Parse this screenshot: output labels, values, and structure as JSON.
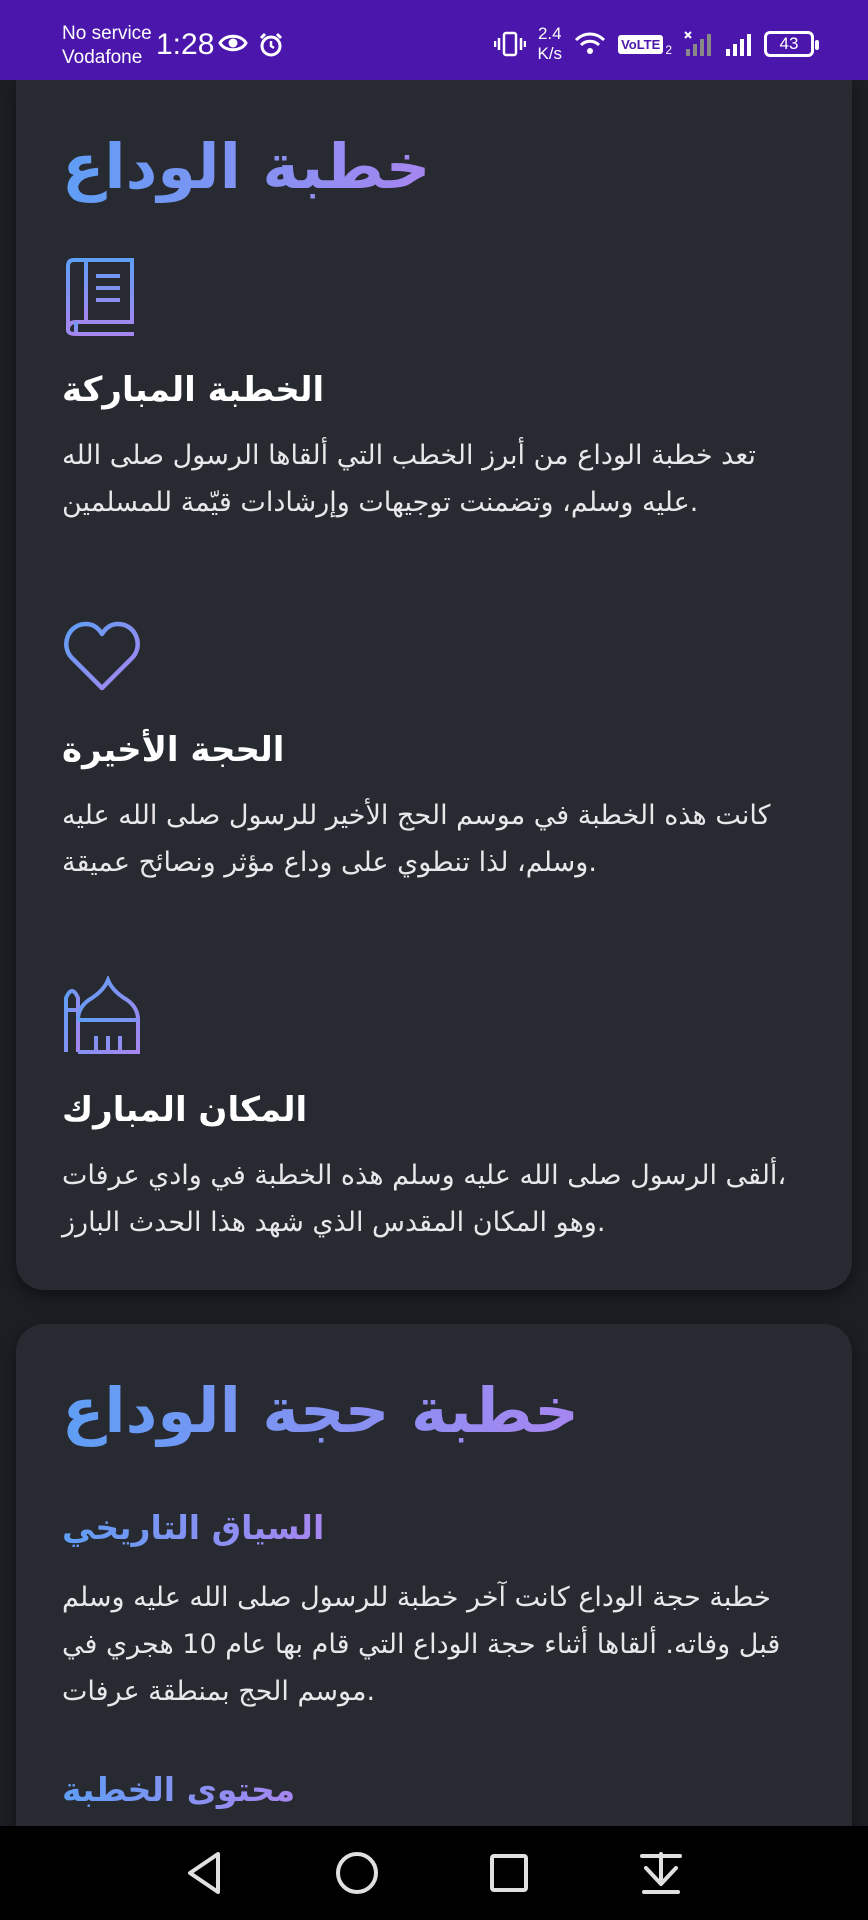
{
  "status_bar": {
    "carrier_line1": "No service",
    "carrier_line2": "Vodafone",
    "time": "1:28",
    "speed_value": "2.4",
    "speed_unit": "K/s",
    "volte": "VoLTE",
    "sim_index": "2",
    "battery": "43"
  },
  "card1": {
    "title": "خطبة الوداع",
    "features": [
      {
        "icon": "book-icon",
        "title": "الخطبة المباركة",
        "line1": "تعد خطبة الوداع من أبرز الخطب التي ألقاها الرسول صلى الله",
        "line2": "عليه وسلم، وتضمنت توجيهات وإرشادات قيّمة للمسلمين."
      },
      {
        "icon": "heart-icon",
        "title": "الحجة الأخيرة",
        "line1": "كانت هذه الخطبة في موسم الحج الأخير للرسول صلى الله عليه",
        "line2": "وسلم، لذا تنطوي على وداع مؤثر ونصائح عميقة."
      },
      {
        "icon": "mosque-icon",
        "title": "المكان المبارك",
        "line1": "ألقى الرسول صلى الله عليه وسلم هذه الخطبة في وادي عرفات،",
        "line2": "وهو المكان المقدس الذي شهد هذا الحدث البارز."
      }
    ]
  },
  "card2": {
    "title": "خطبة حجة الوداع",
    "section1_title": "السياق التاريخي",
    "section1_line1": "خطبة حجة الوداع كانت آخر خطبة للرسول صلى الله عليه وسلم",
    "section1_line2": "قبل وفاته. ألقاها أثناء حجة الوداع التي قام بها عام 10 هجري في",
    "section1_line3": "موسم الحج بمنطقة عرفات.",
    "section2_title": "محتوى الخطبة"
  },
  "colors": {
    "status_bar": "#4a16ab",
    "card": "#272a31",
    "background": "#1c1e24",
    "accent_blue": "#5f9ef5",
    "accent_purple": "#a786f0"
  }
}
